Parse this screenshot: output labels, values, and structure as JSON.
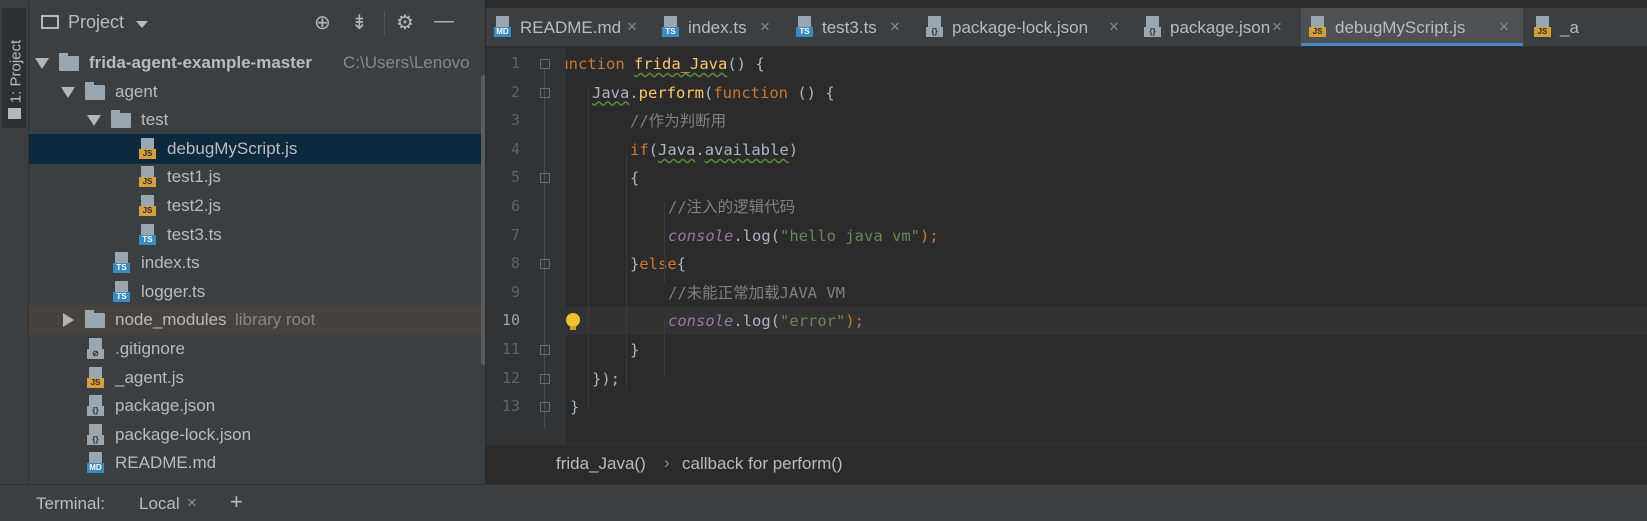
{
  "toolstrip": {
    "project_label": "1: Project"
  },
  "project": {
    "header_title": "Project",
    "tree": [
      {
        "label": "frida-agent-example-master",
        "extra": "C:\\Users\\Lenovo",
        "kind": "folder",
        "expanded": true
      },
      {
        "label": "agent",
        "kind": "folder",
        "expanded": true
      },
      {
        "label": "test",
        "kind": "folder",
        "expanded": true
      },
      {
        "label": "debugMyScript.js",
        "kind": "js",
        "selected": true
      },
      {
        "label": "test1.js",
        "kind": "js"
      },
      {
        "label": "test2.js",
        "kind": "js"
      },
      {
        "label": "test3.ts",
        "kind": "ts"
      },
      {
        "label": "index.ts",
        "kind": "ts"
      },
      {
        "label": "logger.ts",
        "kind": "ts"
      },
      {
        "label": "node_modules",
        "extra": "library root",
        "kind": "folder",
        "expanded": false
      },
      {
        "label": ".gitignore",
        "kind": "git"
      },
      {
        "label": "_agent.js",
        "kind": "js"
      },
      {
        "label": "package.json",
        "kind": "json"
      },
      {
        "label": "package-lock.json",
        "kind": "json"
      },
      {
        "label": "README.md",
        "kind": "md"
      }
    ]
  },
  "tabs": [
    {
      "label": "README.md",
      "kind": "md",
      "tag": "MD"
    },
    {
      "label": "index.ts",
      "kind": "ts",
      "tag": "TS"
    },
    {
      "label": "test3.ts",
      "kind": "ts",
      "tag": "TS"
    },
    {
      "label": "package-lock.json",
      "kind": "json",
      "tag": "{}"
    },
    {
      "label": "package.json",
      "kind": "json",
      "tag": "{}"
    },
    {
      "label": "debugMyScript.js",
      "kind": "js",
      "tag": "JS",
      "active": true
    },
    {
      "label": "_a",
      "kind": "js",
      "tag": "JS"
    }
  ],
  "editor": {
    "line_numbers": [
      "1",
      "2",
      "3",
      "4",
      "5",
      "6",
      "7",
      "8",
      "9",
      "10",
      "11",
      "12",
      "13"
    ],
    "current_line": 10,
    "code": {
      "l1": {
        "kw": "function",
        "name": "frida_Java",
        "rest": "() {"
      },
      "l2": {
        "obj": "Java",
        "dot": ".",
        "method": "perform",
        "open": "(",
        "kw": "function",
        "rest": " () {"
      },
      "l3": {
        "comment": "//作为判断用"
      },
      "l4": {
        "kw": "if",
        "open": "(",
        "obj": "Java",
        "dot": ".",
        "prop": "available",
        "close": ")"
      },
      "l5": {
        "text": "{"
      },
      "l6": {
        "comment": "//注入的逻辑代码"
      },
      "l7": {
        "glob": "console",
        "call": ".log(",
        "str": "\"hello java vm\"",
        "end": ");"
      },
      "l8": {
        "brace": "}",
        "kw": "else",
        "open": "{"
      },
      "l9": {
        "comment": "//未能正常加载JAVA VM"
      },
      "l10": {
        "glob": "console",
        "call": ".log(",
        "str": "\"error\"",
        "end": ");"
      },
      "l11": {
        "text": "}"
      },
      "l12": {
        "text": "});"
      },
      "l13": {
        "text": "}"
      }
    }
  },
  "breadcrumb": {
    "first": "frida_Java()",
    "separator": "›",
    "second": "callback for perform()"
  },
  "terminal": {
    "label": "Terminal:",
    "tab": "Local",
    "close": "×",
    "add": "+"
  }
}
